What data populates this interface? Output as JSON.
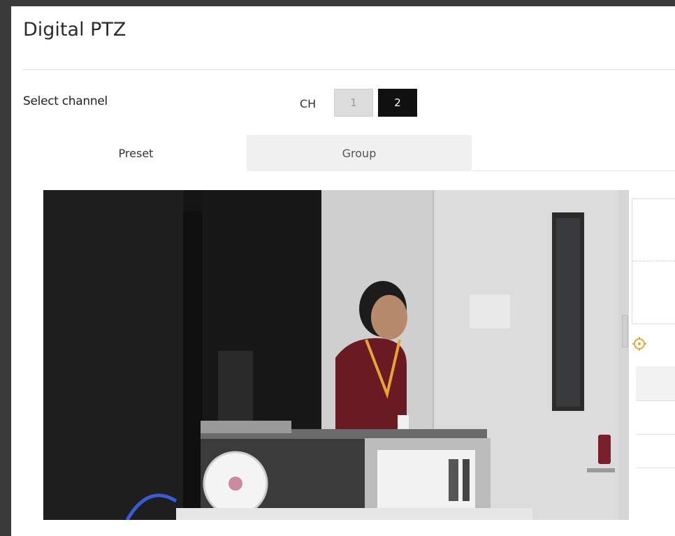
{
  "page": {
    "title": "Digital PTZ"
  },
  "channel": {
    "label": "Select channel",
    "ch_label": "CH",
    "options": [
      "1",
      "2"
    ],
    "selected": "2"
  },
  "tabs": [
    {
      "label": "Preset",
      "active": true
    },
    {
      "label": "Group",
      "active": false
    }
  ],
  "colors": {
    "accent": "#e8a33a",
    "selected_channel_bg": "#111111",
    "inactive_tab_bg": "#f0f0f0"
  },
  "icons": {
    "target": "crosshair-target-icon"
  }
}
